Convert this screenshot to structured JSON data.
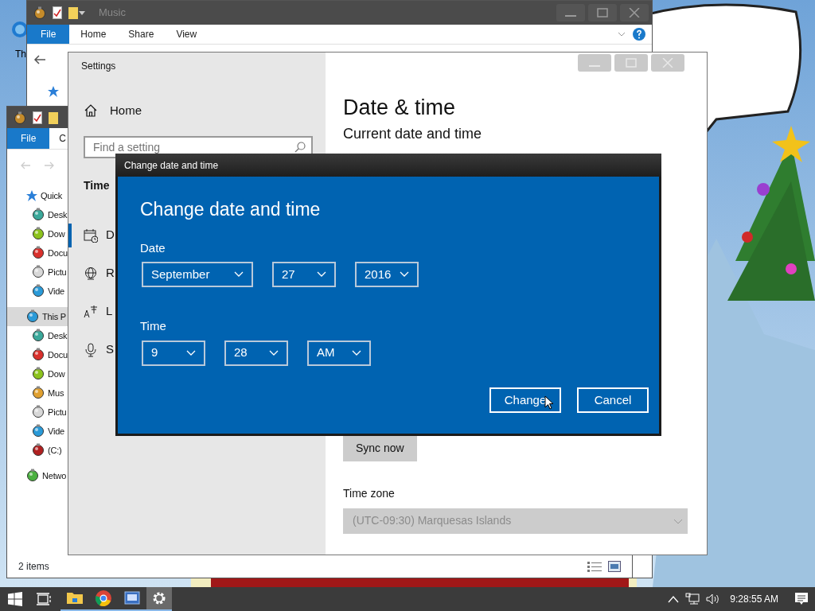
{
  "desktop_icon": {
    "label": "Th"
  },
  "explorer_back": {
    "title": "Music",
    "ribbon_tabs": [
      {
        "label": "File",
        "kind": "file"
      },
      {
        "label": "Home",
        "kind": "tab"
      },
      {
        "label": "Share",
        "kind": "tab"
      },
      {
        "label": "View",
        "kind": "tab"
      }
    ]
  },
  "explorer_front": {
    "ribbon_tabs": [
      {
        "label": "File",
        "kind": "file"
      },
      {
        "label": "C",
        "kind": "tab"
      }
    ],
    "nav": [
      {
        "label": "Quick",
        "selected": false,
        "kind": "star",
        "children": [
          {
            "label": "Desk",
            "selected": false,
            "color": "#3aa89a"
          },
          {
            "label": "Dow",
            "selected": false,
            "color": "#8cc21c"
          },
          {
            "label": "Docu",
            "selected": false,
            "color": "#d9302c"
          },
          {
            "label": "Pictu",
            "selected": false,
            "color": "#d8d8d8"
          },
          {
            "label": "Vide",
            "selected": false,
            "color": "#2a9ad8"
          }
        ]
      },
      {
        "label": "This P",
        "selected": true,
        "kind": "pc",
        "children": [
          {
            "label": "Desk",
            "selected": false,
            "color": "#3aa89a"
          },
          {
            "label": "Docu",
            "selected": false,
            "color": "#d9302c"
          },
          {
            "label": "Dow",
            "selected": false,
            "color": "#8cc21c"
          },
          {
            "label": "Mus",
            "selected": false,
            "color": "#e0a030"
          },
          {
            "label": "Pictu",
            "selected": false,
            "color": "#d8d8d8"
          },
          {
            "label": "Vide",
            "selected": false,
            "color": "#2a9ad8"
          },
          {
            "label": "(C:)",
            "selected": false,
            "color": "#b02020"
          }
        ]
      },
      {
        "label": "Netwo",
        "selected": false,
        "kind": "network"
      }
    ],
    "status": "2 items"
  },
  "settings": {
    "title": "Settings",
    "home": "Home",
    "search": {
      "placeholder": "Find a setting"
    },
    "section": "Time",
    "nav": [
      {
        "label": "D",
        "kind": "calendar",
        "selected": true
      },
      {
        "label": "R",
        "kind": "globe",
        "selected": false
      },
      {
        "label": "L",
        "kind": "language",
        "selected": false
      },
      {
        "label": "S",
        "kind": "microphone",
        "selected": false
      }
    ],
    "heading": "Date & time",
    "subheading": "Current date and time",
    "sync_button": "Sync now",
    "time_zone_label": "Time zone",
    "time_zone": {
      "value": "(UTC-09:30) Marquesas Islands",
      "disabled": true
    }
  },
  "dialog": {
    "title": "Change date and time",
    "heading": "Change date and time",
    "date_label": "Date",
    "date_fields": [
      "September",
      "27",
      "2016"
    ],
    "time_label": "Time",
    "time_fields": [
      "9",
      "28",
      "AM"
    ],
    "buttons": [
      "Change",
      "Cancel"
    ]
  },
  "taskbar": {
    "apps": [
      {
        "kind": "folder",
        "active": false
      },
      {
        "kind": "browser",
        "active": false
      },
      {
        "kind": "vb",
        "active": false
      },
      {
        "kind": "gear",
        "active": true
      }
    ],
    "clock": "9:28:55 AM"
  }
}
